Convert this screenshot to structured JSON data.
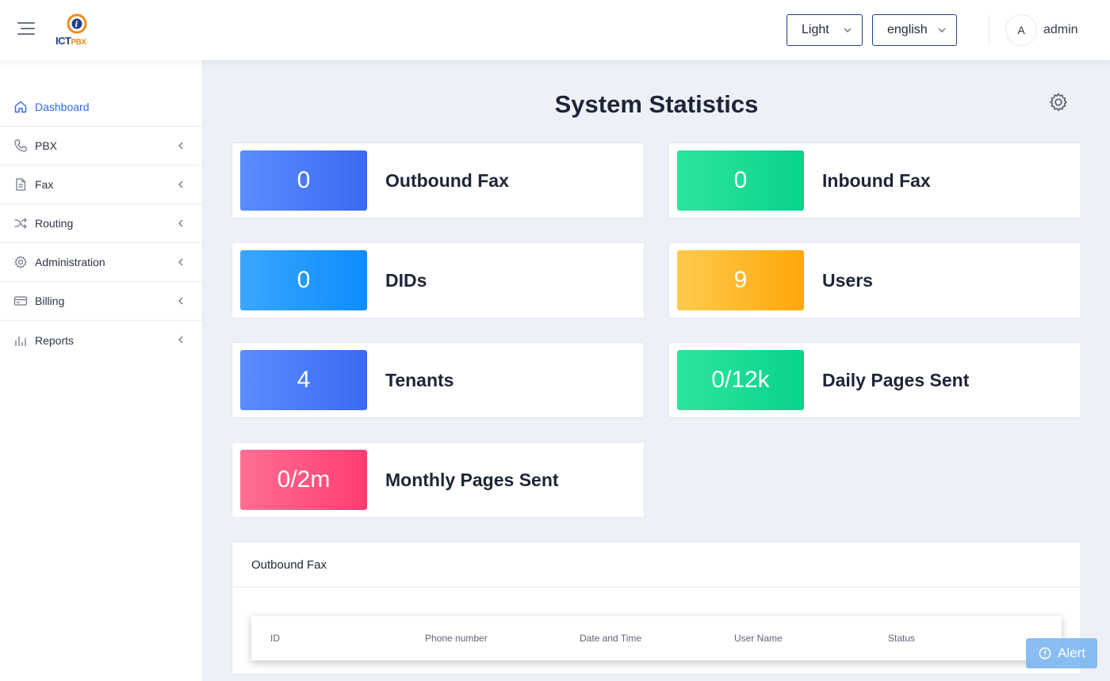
{
  "header": {
    "logo": {
      "ict": "ICT",
      "pbx": "PBX"
    },
    "theme_select": {
      "value": "Light"
    },
    "language_select": {
      "value": "english"
    },
    "avatar_initial": "A",
    "username": "admin"
  },
  "sidebar": {
    "items": [
      {
        "label": "Dashboard",
        "icon": "home-icon",
        "active": true
      },
      {
        "label": "PBX",
        "icon": "phone-icon"
      },
      {
        "label": "Fax",
        "icon": "document-icon"
      },
      {
        "label": "Routing",
        "icon": "shuffle-icon"
      },
      {
        "label": "Administration",
        "icon": "gear-icon"
      },
      {
        "label": "Billing",
        "icon": "credit-card-icon"
      },
      {
        "label": "Reports",
        "icon": "bar-chart-icon"
      }
    ]
  },
  "main": {
    "title": "System Statistics",
    "cards": [
      {
        "value": "0",
        "label": "Outbound Fax",
        "color": "#3b6af2"
      },
      {
        "value": "0",
        "label": "Inbound Fax",
        "color": "#08d38a"
      },
      {
        "value": "0",
        "label": "DIDs",
        "color": "#0e8cff"
      },
      {
        "value": "9",
        "label": "Users",
        "color": "#ffa70a"
      },
      {
        "value": "4",
        "label": "Tenants",
        "color": "#3b6af2"
      },
      {
        "value": "0/12k",
        "label": "Daily Pages Sent",
        "color": "#08d38a"
      },
      {
        "value": "0/2m",
        "label": "Monthly Pages Sent",
        "color": "#ff3d72"
      }
    ],
    "outbound_panel": {
      "title": "Outbound Fax",
      "columns": [
        "ID",
        "Phone number",
        "Date and Time",
        "User Name",
        "Status"
      ]
    }
  },
  "alert_button": {
    "label": "Alert"
  }
}
